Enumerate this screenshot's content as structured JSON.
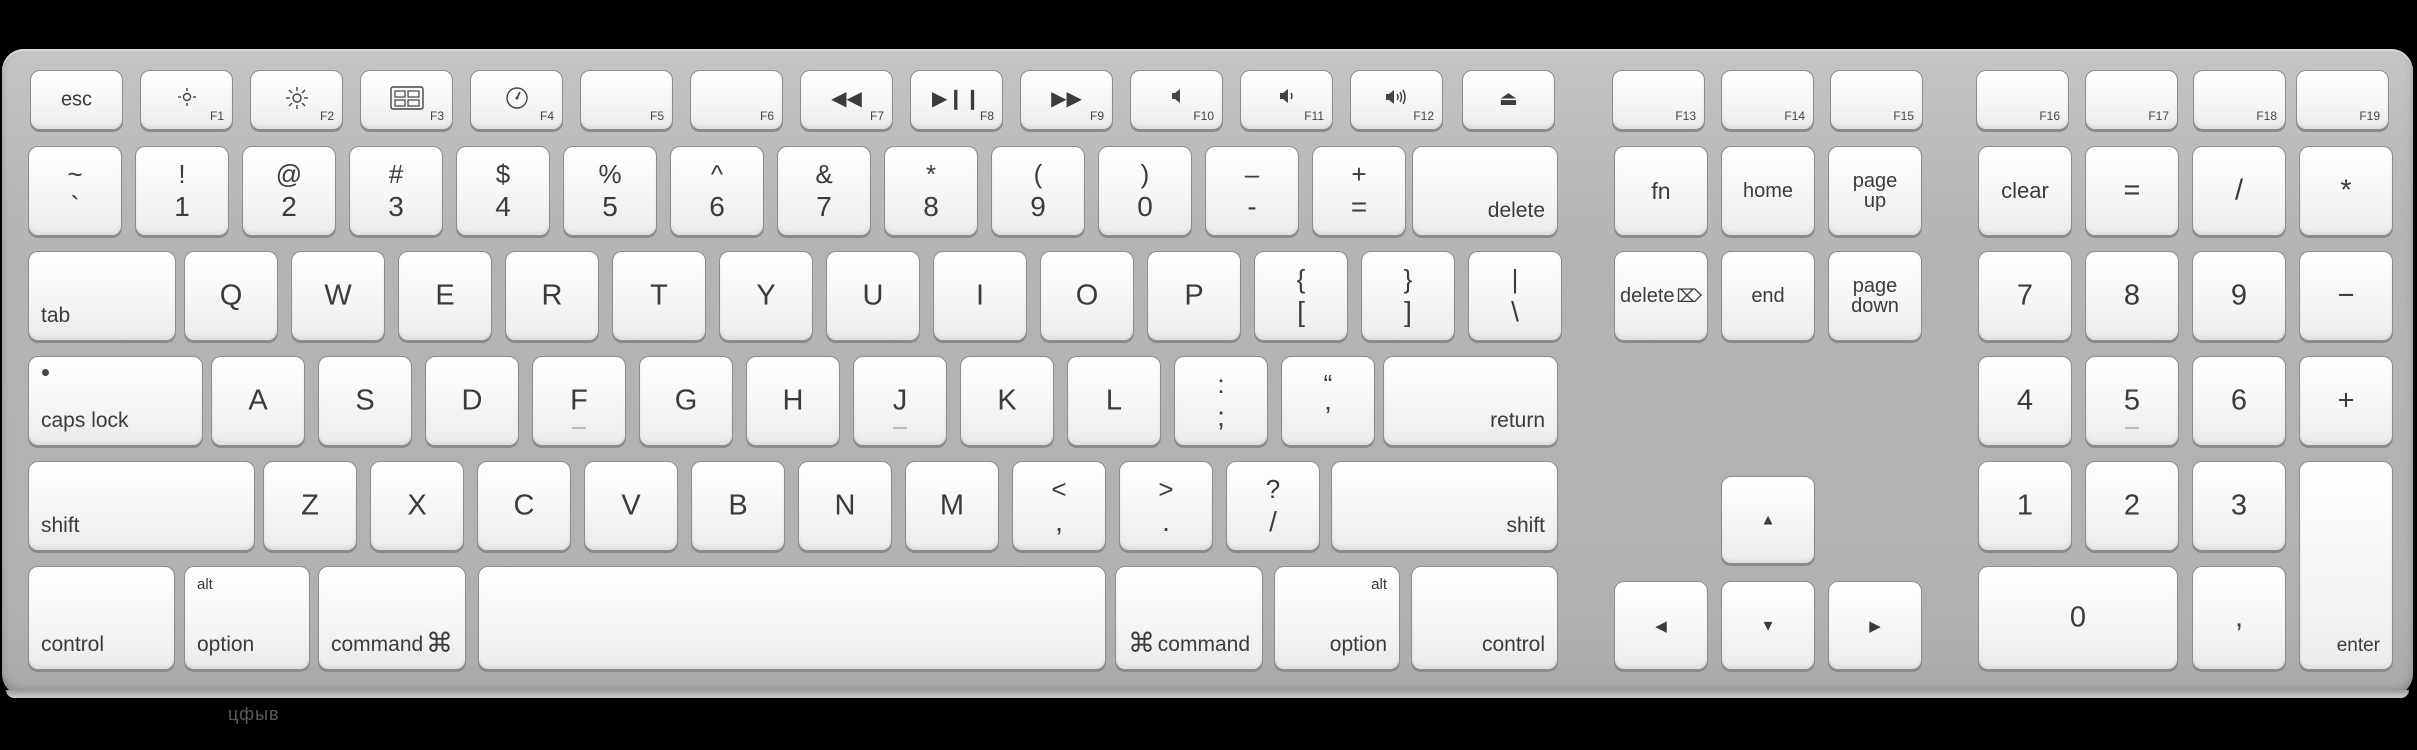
{
  "keyboard": {
    "function_row": [
      {
        "id": "esc",
        "main": "esc"
      },
      {
        "id": "f1",
        "fn": "F1",
        "icon": "brightness-down-icon"
      },
      {
        "id": "f2",
        "fn": "F2",
        "icon": "brightness-up-icon"
      },
      {
        "id": "f3",
        "fn": "F3",
        "icon": "mission-control-icon"
      },
      {
        "id": "f4",
        "fn": "F4",
        "icon": "dashboard-icon"
      },
      {
        "id": "f5",
        "fn": "F5"
      },
      {
        "id": "f6",
        "fn": "F6"
      },
      {
        "id": "f7",
        "fn": "F7",
        "icon": "rewind-icon",
        "glyph": "◀◀"
      },
      {
        "id": "f8",
        "fn": "F8",
        "icon": "play-pause-icon",
        "glyph": "▶❙❙"
      },
      {
        "id": "f9",
        "fn": "F9",
        "icon": "fast-forward-icon",
        "glyph": "▶▶"
      },
      {
        "id": "f10",
        "fn": "F10",
        "icon": "mute-icon"
      },
      {
        "id": "f11",
        "fn": "F11",
        "icon": "volume-down-icon"
      },
      {
        "id": "f12",
        "fn": "F12",
        "icon": "volume-up-icon"
      },
      {
        "id": "eject",
        "icon": "eject-icon",
        "glyph": "⏏"
      },
      {
        "id": "f13",
        "fn": "F13"
      },
      {
        "id": "f14",
        "fn": "F14"
      },
      {
        "id": "f15",
        "fn": "F15"
      },
      {
        "id": "f16",
        "fn": "F16"
      },
      {
        "id": "f17",
        "fn": "F17"
      },
      {
        "id": "f18",
        "fn": "F18"
      },
      {
        "id": "f19",
        "fn": "F19"
      }
    ],
    "number_row": [
      {
        "id": "grave",
        "top": "~",
        "bottom": "`"
      },
      {
        "id": "1",
        "top": "!",
        "bottom": "1"
      },
      {
        "id": "2",
        "top": "@",
        "bottom": "2"
      },
      {
        "id": "3",
        "top": "#",
        "bottom": "3"
      },
      {
        "id": "4",
        "top": "$",
        "bottom": "4"
      },
      {
        "id": "5",
        "top": "%",
        "bottom": "5"
      },
      {
        "id": "6",
        "top": "^",
        "bottom": "6"
      },
      {
        "id": "7",
        "top": "&",
        "bottom": "7"
      },
      {
        "id": "8",
        "top": "*",
        "bottom": "8"
      },
      {
        "id": "9",
        "top": "(",
        "bottom": "9"
      },
      {
        "id": "0",
        "top": ")",
        "bottom": "0"
      },
      {
        "id": "minus",
        "top": "–",
        "bottom": "-"
      },
      {
        "id": "equals",
        "top": "+",
        "bottom": "="
      },
      {
        "id": "delete",
        "label": "delete"
      }
    ],
    "qwerty_row": [
      {
        "id": "tab",
        "label": "tab"
      },
      {
        "id": "q",
        "main": "Q"
      },
      {
        "id": "w",
        "main": "W"
      },
      {
        "id": "e",
        "main": "E"
      },
      {
        "id": "r",
        "main": "R"
      },
      {
        "id": "t",
        "main": "T"
      },
      {
        "id": "y",
        "main": "Y"
      },
      {
        "id": "u",
        "main": "U"
      },
      {
        "id": "i",
        "main": "I"
      },
      {
        "id": "o",
        "main": "O"
      },
      {
        "id": "p",
        "main": "P"
      },
      {
        "id": "lbracket",
        "top": "{",
        "bottom": "["
      },
      {
        "id": "rbracket",
        "top": "}",
        "bottom": "]"
      },
      {
        "id": "backslash",
        "top": "|",
        "bottom": "\\"
      }
    ],
    "home_row": [
      {
        "id": "capslock",
        "label": "caps lock"
      },
      {
        "id": "a",
        "main": "A"
      },
      {
        "id": "s",
        "main": "S"
      },
      {
        "id": "d",
        "main": "D"
      },
      {
        "id": "f",
        "main": "F"
      },
      {
        "id": "g",
        "main": "G"
      },
      {
        "id": "h",
        "main": "H"
      },
      {
        "id": "j",
        "main": "J"
      },
      {
        "id": "k",
        "main": "K"
      },
      {
        "id": "l",
        "main": "L"
      },
      {
        "id": "semicolon",
        "top": ":",
        "bottom": ";"
      },
      {
        "id": "quote",
        "top": "“",
        "bottom": "’"
      },
      {
        "id": "return",
        "label": "return"
      }
    ],
    "shift_row": [
      {
        "id": "lshift",
        "label": "shift"
      },
      {
        "id": "z",
        "main": "Z"
      },
      {
        "id": "x",
        "main": "X"
      },
      {
        "id": "c",
        "main": "C"
      },
      {
        "id": "v",
        "main": "V"
      },
      {
        "id": "b",
        "main": "B"
      },
      {
        "id": "n",
        "main": "N"
      },
      {
        "id": "m",
        "main": "M"
      },
      {
        "id": "comma",
        "top": "<",
        "bottom": ","
      },
      {
        "id": "period",
        "top": ">",
        "bottom": "."
      },
      {
        "id": "slash",
        "top": "?",
        "bottom": "/"
      },
      {
        "id": "rshift",
        "label": "shift"
      }
    ],
    "bottom_row": [
      {
        "id": "lcontrol",
        "label": "control"
      },
      {
        "id": "loption",
        "label": "option",
        "sub": "alt"
      },
      {
        "id": "lcommand",
        "label": "command",
        "symbol": "⌘"
      },
      {
        "id": "space",
        "label": ""
      },
      {
        "id": "rcommand",
        "label": "command",
        "symbol": "⌘"
      },
      {
        "id": "roption",
        "label": "option",
        "sub": "alt"
      },
      {
        "id": "rcontrol",
        "label": "control"
      }
    ],
    "nav_cluster": [
      {
        "id": "fn",
        "main": "fn"
      },
      {
        "id": "home",
        "main": "home"
      },
      {
        "id": "pageup",
        "main": "page\nup"
      },
      {
        "id": "fwddelete",
        "main": "delete",
        "icon": "forward-delete-icon",
        "glyph": "⌦"
      },
      {
        "id": "end",
        "main": "end"
      },
      {
        "id": "pagedown",
        "main": "page\ndown"
      }
    ],
    "arrows": [
      {
        "id": "up",
        "icon": "arrow-up-icon",
        "glyph": "▲"
      },
      {
        "id": "left",
        "icon": "arrow-left-icon",
        "glyph": "◀"
      },
      {
        "id": "down",
        "icon": "arrow-down-icon",
        "glyph": "▼"
      },
      {
        "id": "right",
        "icon": "arrow-right-icon",
        "glyph": "▶"
      }
    ],
    "numpad": [
      {
        "id": "clear",
        "main": "clear"
      },
      {
        "id": "kp-equals",
        "main": "="
      },
      {
        "id": "kp-divide",
        "main": "/"
      },
      {
        "id": "kp-multiply",
        "main": "*"
      },
      {
        "id": "kp7",
        "main": "7"
      },
      {
        "id": "kp8",
        "main": "8"
      },
      {
        "id": "kp9",
        "main": "9"
      },
      {
        "id": "kp-minus",
        "main": "−"
      },
      {
        "id": "kp4",
        "main": "4"
      },
      {
        "id": "kp5",
        "main": "5"
      },
      {
        "id": "kp6",
        "main": "6"
      },
      {
        "id": "kp-plus",
        "main": "+"
      },
      {
        "id": "kp1",
        "main": "1"
      },
      {
        "id": "kp2",
        "main": "2"
      },
      {
        "id": "kp3",
        "main": "3"
      },
      {
        "id": "kp0",
        "main": "0"
      },
      {
        "id": "kp-decimal",
        "main": ","
      },
      {
        "id": "kp-enter",
        "label": "enter"
      }
    ]
  },
  "watermark": "цфыв",
  "colors": {
    "board": "#b3b3b3",
    "key_top": "#ffffff",
    "key_border": "#8d8d8d",
    "legend": "#3b3b3b"
  }
}
